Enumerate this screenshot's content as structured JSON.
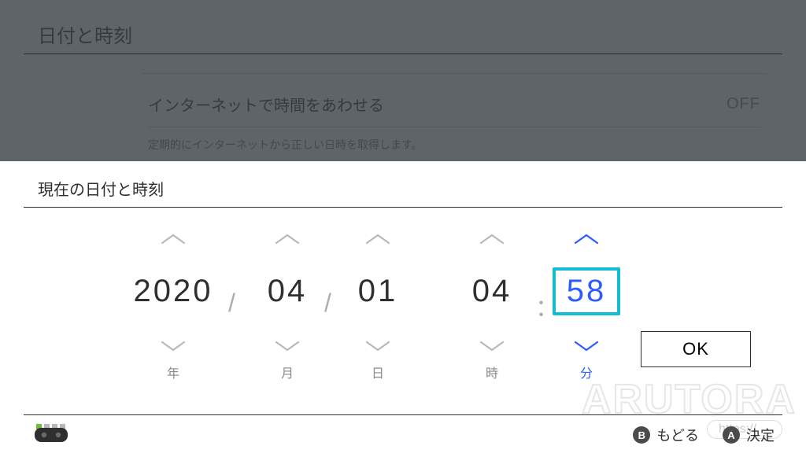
{
  "bg": {
    "title": "日付と時刻",
    "sync_label": "インターネットで時間をあわせる",
    "sync_value": "OFF",
    "sync_note": "定期的にインターネットから正しい日時を取得します。"
  },
  "modal": {
    "title": "現在の日付と時刻",
    "ok": "OK"
  },
  "picker": {
    "year": {
      "value": "2020",
      "unit": "年",
      "active": false
    },
    "month": {
      "value": "04",
      "unit": "月",
      "active": false
    },
    "day": {
      "value": "01",
      "unit": "日",
      "active": false
    },
    "hour": {
      "value": "04",
      "unit": "時",
      "active": false
    },
    "min": {
      "value": "58",
      "unit": "分",
      "active": true
    },
    "sep_date": "/",
    "sep_time": "："
  },
  "hints": {
    "b": {
      "glyph": "B",
      "label": "もどる"
    },
    "a": {
      "glyph": "A",
      "label": "決定"
    }
  },
  "watermark": {
    "text": "ARUTORA",
    "url": "https://"
  }
}
